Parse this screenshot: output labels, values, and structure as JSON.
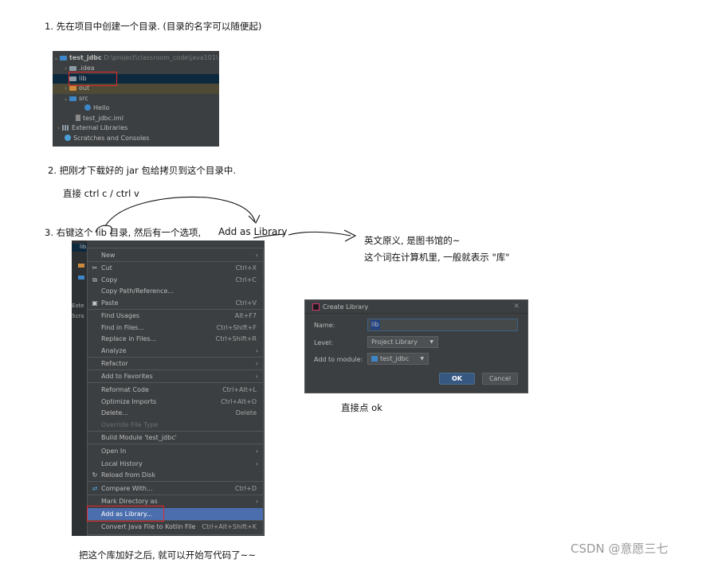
{
  "notes": {
    "step1": "1. 先在项目中创建一个目录. (目录的名字可以随便起)",
    "step2": "2. 把刚才下载好的 jar 包给拷贝到这个目录中.",
    "copy_hint": "直接 ctrl c / ctrl v",
    "step3": "3. 右键这个 lib 目录, 然后有一个选项,",
    "add_as_library": "Add as Library",
    "meaning_line1": "英文原义, 是图书馆的~",
    "meaning_line2": "这个词在计算机里, 一般就表示 \"库\"",
    "click_ok": "直接点 ok",
    "finish": "把这个库加好之后, 就可以开始写代码了~~"
  },
  "project_tree": {
    "root_name": "test_jdbc",
    "root_path": "D:\\project\\classroom_code\\java101\\",
    "items": [
      {
        "label": ".idea"
      },
      {
        "label": "lib"
      },
      {
        "label": "out"
      },
      {
        "label": "src"
      },
      {
        "label": "Hello"
      },
      {
        "label": "test_jdbc.iml"
      },
      {
        "label": "External Libraries"
      },
      {
        "label": "Scratches and Consoles"
      }
    ]
  },
  "side_tree": {
    "items": [
      "lib",
      "Exte",
      "Scra"
    ]
  },
  "context_menu": {
    "items": [
      {
        "label": "New"
      },
      {
        "label": "Cut",
        "shortcut": "Ctrl+X"
      },
      {
        "label": "Copy",
        "shortcut": "Ctrl+C"
      },
      {
        "label": "Copy Path/Reference..."
      },
      {
        "label": "Paste",
        "shortcut": "Ctrl+V"
      },
      {
        "label": "Find Usages",
        "shortcut": "Alt+F7"
      },
      {
        "label": "Find in Files...",
        "shortcut": "Ctrl+Shift+F"
      },
      {
        "label": "Replace in Files...",
        "shortcut": "Ctrl+Shift+R"
      },
      {
        "label": "Analyze"
      },
      {
        "label": "Refactor"
      },
      {
        "label": "Add to Favorites"
      },
      {
        "label": "Reformat Code",
        "shortcut": "Ctrl+Alt+L"
      },
      {
        "label": "Optimize Imports",
        "shortcut": "Ctrl+Alt+O"
      },
      {
        "label": "Delete...",
        "shortcut": "Delete"
      },
      {
        "label": "Override File Type"
      },
      {
        "label": "Build Module 'test_jdbc'"
      },
      {
        "label": "Open In"
      },
      {
        "label": "Local History"
      },
      {
        "label": "Reload from Disk"
      },
      {
        "label": "Compare With...",
        "shortcut": "Ctrl+D"
      },
      {
        "label": "Mark Directory as"
      },
      {
        "label": "Add as Library..."
      },
      {
        "label": "Convert Java File to Kotlin File",
        "shortcut": "Ctrl+Alt+Shift+K"
      }
    ]
  },
  "dialog": {
    "title": "Create Library",
    "name_label": "Name:",
    "name_value": "lib",
    "level_label": "Level:",
    "level_value": "Project Library",
    "module_label": "Add to module:",
    "module_value": "test_jdbc",
    "ok_label": "OK",
    "cancel_label": "Cancel"
  },
  "watermark": "CSDN @意愿三七",
  "colors": {
    "ide_bg": "#3c3f41",
    "highlight": "#4b6eaf",
    "annotation_red": "#e2282b",
    "ok_button": "#365880"
  }
}
